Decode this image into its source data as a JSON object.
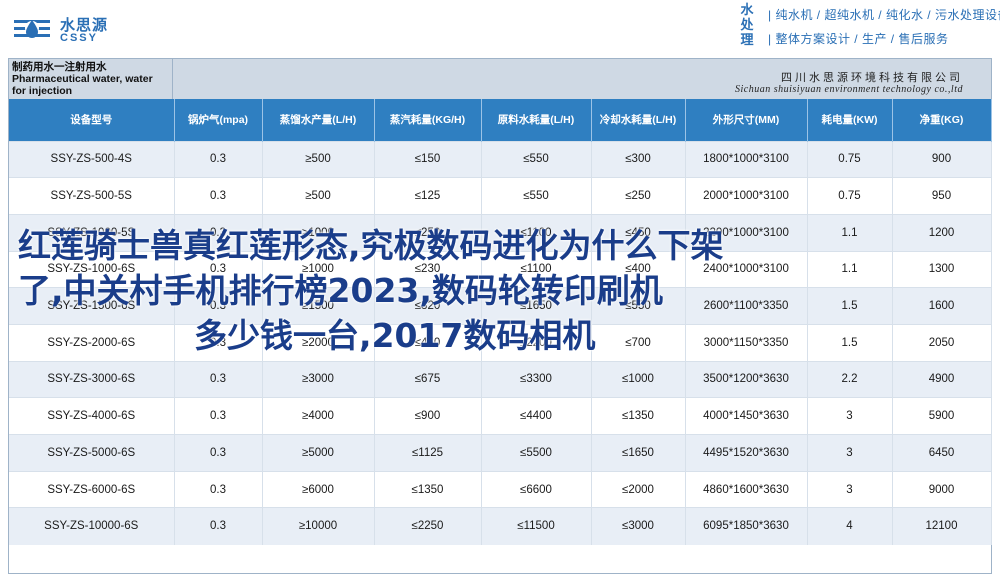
{
  "header": {
    "logo_cn": "水思源",
    "logo_en": "CSSY",
    "slogan_vertical": "水处理",
    "slogan_line1": "| 纯水机 / 超纯水机 / 纯化水 / 污水处理设备",
    "slogan_line2": "| 整体方案设计 / 生产 / 售后服务"
  },
  "table": {
    "product_name_cn": "制药用水一注射用水",
    "product_name_en": "Pharmaceutical water, water for injection",
    "company_cn": "四川水思源环境科技有限公司",
    "company_en": "Sichuan shuisiyuan environment technology co.,ltd",
    "columns": [
      "设备型号",
      "锅炉气(mpa)",
      "蒸馏水产量(L/H)",
      "蒸汽耗量(KG/H)",
      "原料水耗量(L/H)",
      "冷却水耗量(L/H)",
      "外形尺寸(MM)",
      "耗电量(KW)",
      "净重(KG)"
    ],
    "rows": [
      [
        "SSY-ZS-500-4S",
        "0.3",
        "≥500",
        "≤150",
        "≤550",
        "≤300",
        "1800*1000*3100",
        "0.75",
        "900"
      ],
      [
        "SSY-ZS-500-5S",
        "0.3",
        "≥500",
        "≤125",
        "≤550",
        "≤250",
        "2000*1000*3100",
        "0.75",
        "950"
      ],
      [
        "SSY-ZS-1000-5S",
        "0.3",
        "≥1000",
        "≤250",
        "≤1100",
        "≤450",
        "2200*1000*3100",
        "1.1",
        "1200"
      ],
      [
        "SSY-ZS-1000-6S",
        "0.3",
        "≥1000",
        "≤230",
        "≤1100",
        "≤400",
        "2400*1000*3100",
        "1.1",
        "1300"
      ],
      [
        "SSY-ZS-1500-6S",
        "0.3",
        "≥1500",
        "≤320",
        "≤1650",
        "≤550",
        "2600*1100*3350",
        "1.5",
        "1600"
      ],
      [
        "SSY-ZS-2000-6S",
        "0.3",
        "≥2000",
        "≤450",
        "≤2200",
        "≤700",
        "3000*1150*3350",
        "1.5",
        "2050"
      ],
      [
        "SSY-ZS-3000-6S",
        "0.3",
        "≥3000",
        "≤675",
        "≤3300",
        "≤1000",
        "3500*1200*3630",
        "2.2",
        "4900"
      ],
      [
        "SSY-ZS-4000-6S",
        "0.3",
        "≥4000",
        "≤900",
        "≤4400",
        "≤1350",
        "4000*1450*3630",
        "3",
        "5900"
      ],
      [
        "SSY-ZS-5000-6S",
        "0.3",
        "≥5000",
        "≤1125",
        "≤5500",
        "≤1650",
        "4495*1520*3630",
        "3",
        "6450"
      ],
      [
        "SSY-ZS-6000-6S",
        "0.3",
        "≥6000",
        "≤1350",
        "≤6600",
        "≤2000",
        "4860*1600*3630",
        "3",
        "9000"
      ],
      [
        "SSY-ZS-10000-6S",
        "0.3",
        "≥10000",
        "≤2250",
        "≤11500",
        "≤3000",
        "6095*1850*3630",
        "4",
        "12100"
      ]
    ]
  },
  "overlay": {
    "line1": "红莲骑士兽真红莲形态,究极数码进化为什么下架",
    "line2": "了,中关村手机排行榜2023,数码轮转印刷机",
    "line3": "多少钱一台,2017数码相机"
  },
  "colors": {
    "brand_blue": "#2a6fb5",
    "header_blue": "#2f7fc1",
    "stripe": "#e8eef6",
    "overlay_text": "#1a3d8a"
  }
}
